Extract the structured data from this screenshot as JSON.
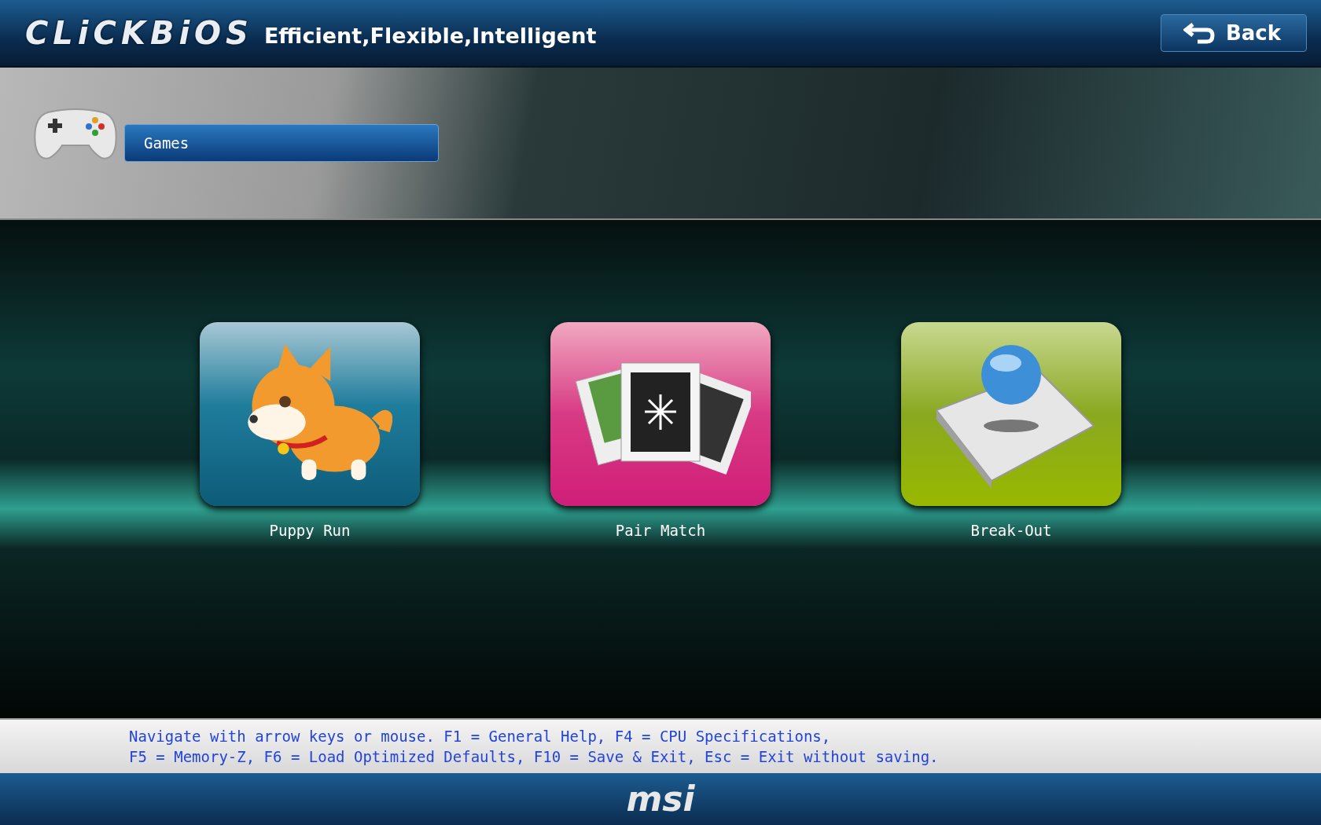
{
  "header": {
    "logo": "CLiCKBiOS",
    "tagline": "Efficient,Flexible,Intelligent",
    "back_button": "Back"
  },
  "category": {
    "label": "Games"
  },
  "games": [
    {
      "name": "Puppy Run",
      "kind": "puppy"
    },
    {
      "name": "Pair Match",
      "kind": "cards"
    },
    {
      "name": "Break-Out",
      "kind": "ball"
    }
  ],
  "help": [
    "Navigate with arrow keys or mouse. F1 = General Help, F4 = CPU Specifications,",
    "F5 = Memory-Z, F6 = Load Optimized Defaults, F10 = Save & Exit, Esc = Exit without saving."
  ],
  "footer": {
    "logo": "msi"
  }
}
